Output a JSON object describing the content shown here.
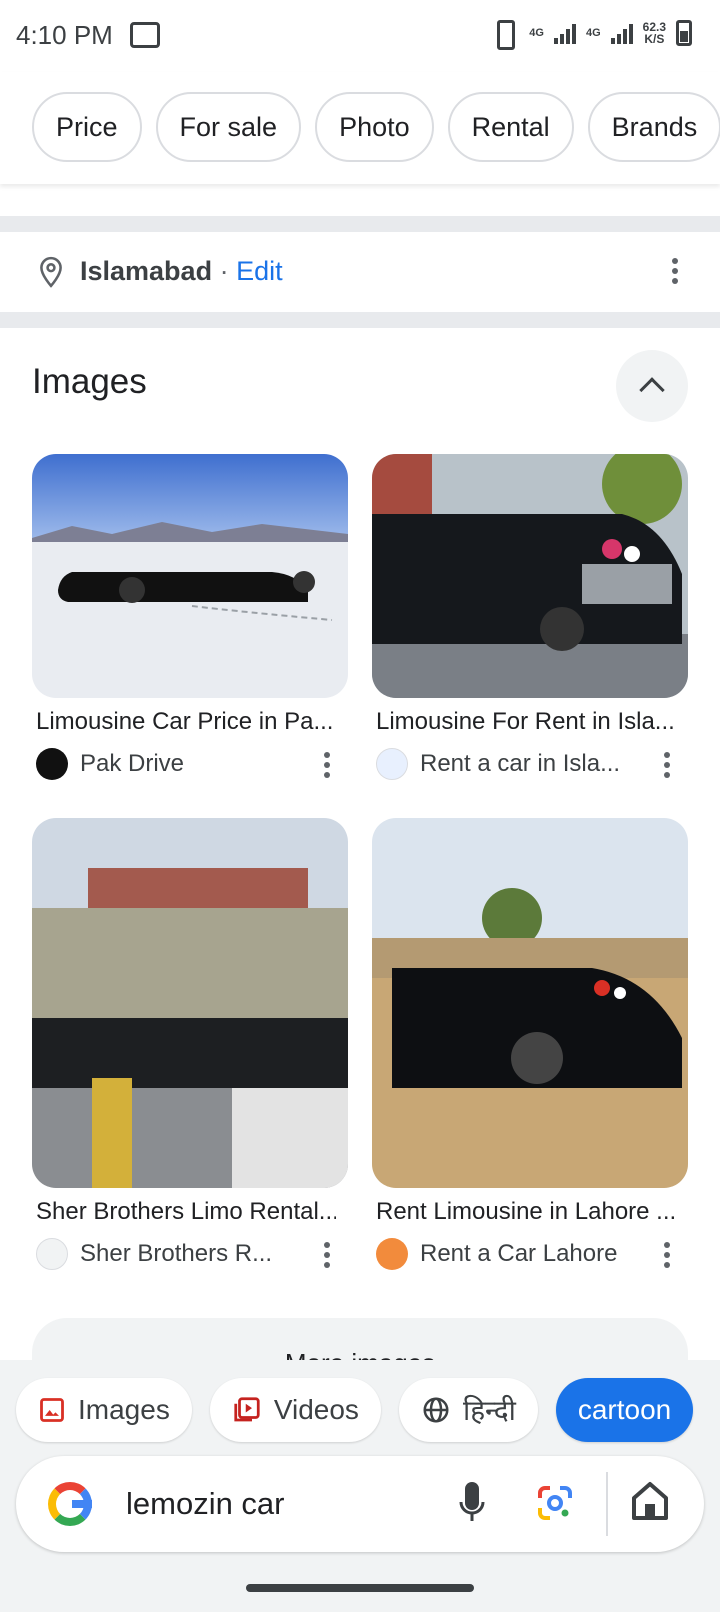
{
  "status_bar": {
    "time": "4:10 PM",
    "network": "4G",
    "network2": "4G",
    "speed_value": "62.3",
    "speed_unit": "K/S"
  },
  "filter_chips": [
    "Price",
    "For sale",
    "Photo",
    "Rental",
    "Brands"
  ],
  "location": {
    "city": "Islamabad",
    "separator": " · ",
    "edit_label": "Edit"
  },
  "images_section": {
    "title": "Images",
    "results": [
      {
        "title": "Limousine Car Price in Pa...",
        "source": "Pak Drive"
      },
      {
        "title": "Limousine For Rent in Isla...",
        "source": "Rent a car in Isla..."
      },
      {
        "title": "Sher Brothers Limo Rental...",
        "source": "Sher Brothers R..."
      },
      {
        "title": "Rent Limousine in Lahore ...",
        "source": "Rent a Car Lahore"
      }
    ],
    "more_label": "More images"
  },
  "bottom_chips": {
    "images": "Images",
    "videos": "Videos",
    "hindi": "हिन्दी",
    "suggestion": "cartoon"
  },
  "search": {
    "query": "lemozin car"
  },
  "colors": {
    "accent": "#1a73e8",
    "images_icon": "#d93025",
    "videos_icon": "#c5221f"
  }
}
